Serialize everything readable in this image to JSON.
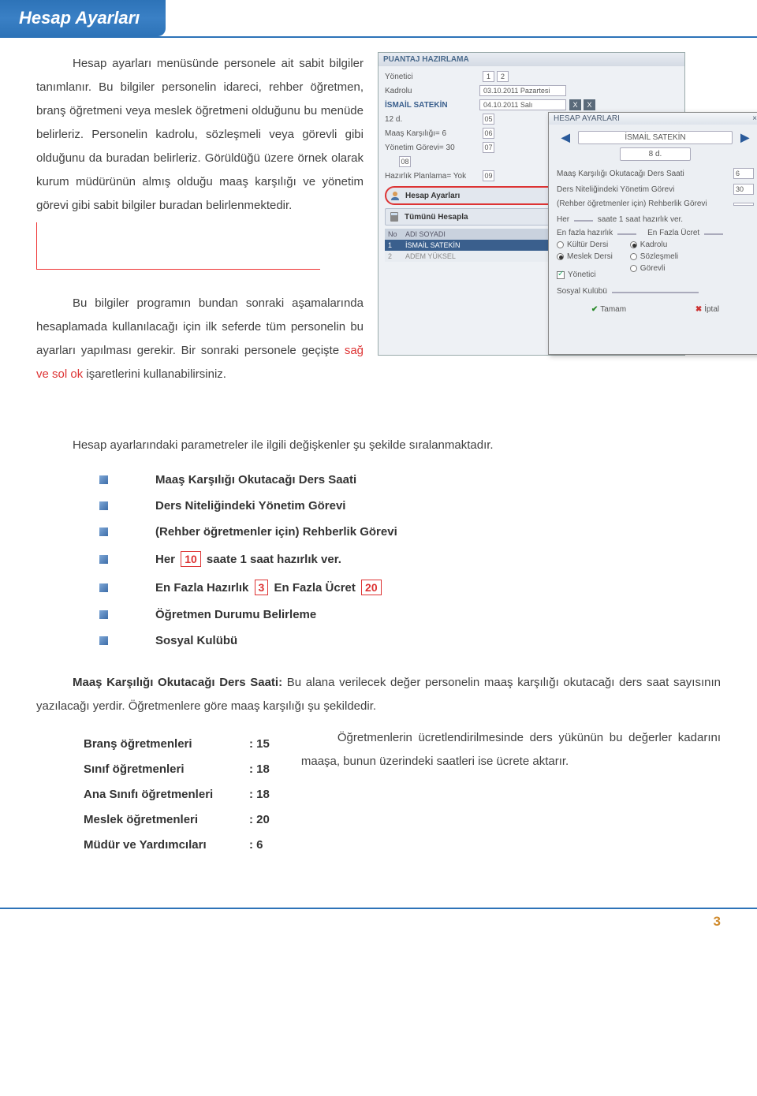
{
  "header": {
    "title": "Hesap Ayarları"
  },
  "body": {
    "p1": "Hesap ayarları menüsünde personele ait sabit bilgiler tanımlanır. Bu bilgiler personelin idareci, rehber öğretmen, branş öğretmeni veya meslek öğretmeni olduğunu bu menüde belirleriz. Personelin kadrolu, sözleşmeli veya görevli gibi olduğunu da buradan belirleriz. Görüldüğü üzere örnek olarak kurum müdürünün almış olduğu maaş karşılığı ve yönetim görevi gibi sabit bilgiler buradan belirlenmektedir.",
    "p2a": "Bu bilgiler programın bundan sonraki aşamalarında hesaplamada kullanılacağı için ilk seferde tüm personelin bu ayarları yapılması gerekir. Bir sonraki personele geçişte ",
    "p2_red1": "sağ ve sol ok",
    "p2b": " işaretlerini kullanabilirsiniz.",
    "p3": "Hesap ayarlarındaki parametreler ile ilgili değişkenler şu şekilde sıralanmaktadır.",
    "p4a": "Maaş Karşılığı Okutacağı Ders Saati:",
    "p4b": " Bu alana verilecek değer personelin maaş karşılığı okutacağı ders saat sayısının yazılacağı yerdir. Öğretmenlere göre maaş karşılığı şu şekildedir.",
    "p5": "Öğretmenlerin ücretlendirilmesinde ders yükünün bu değerler kadarını maaşa, bunun üzerindeki saatleri ise ücrete aktarır."
  },
  "bullets": {
    "b1": "Maaş Karşılığı Okutacağı Ders Saati",
    "b2": "Ders Niteliğindeki Yönetim Görevi",
    "b3": "(Rehber öğretmenler için) Rehberlik Görevi",
    "b4a": "Her ",
    "b4_box": "10",
    "b4b": " saate 1 saat hazırlık ver.",
    "b5a": "En Fazla Hazırlık ",
    "b5_box1": "3",
    "b5b": "   En Fazla Ücret  ",
    "b5_box2": "20",
    "b6": "Öğretmen Durumu Belirleme",
    "b7": "Sosyal Kulübü"
  },
  "table": {
    "r1k": "Branş öğretmenleri",
    "r1v": ": 15",
    "r2k": "Sınıf öğretmenleri",
    "r2v": ": 18",
    "r3k": "Ana Sınıfı öğretmenleri",
    "r3v": ": 18",
    "r4k": "Meslek öğretmenleri",
    "r4v": ": 20",
    "r5k": "Müdür ve Yardımcıları",
    "r5v": ": 6"
  },
  "app": {
    "title": "PUANTAJ HAZIRLAMA",
    "rows": {
      "r1_lbl": "Yönetici",
      "r2_lbl": "Kadrolu",
      "r2_val": "03.10.2011 Pazartesi",
      "r3_lbl": "İSMAİL SATEKİN",
      "r3_val": "04.10.2011 Salı",
      "r4_lbl": "12 d.",
      "r5_lbl": "Maaş Karşılığı= 6",
      "r6_lbl": "Yönetim Görevi= 30",
      "r7_lbl": "Hazırlık Planlama= Yok"
    },
    "nums": {
      "n1": "1",
      "n2": "2",
      "x1": "X",
      "x2": "X",
      "d05": "05",
      "d06": "06",
      "d07": "07",
      "d08": "08",
      "d09": "09"
    },
    "btn1": "Hesap Ayarları",
    "btn2": "Tümünü Hesapla",
    "list": {
      "h_no": "No",
      "h_name": "ADI SOYADI",
      "r1_no": "1",
      "r1_name": "İSMAİL SATEKİN",
      "r2_no": "2",
      "r2_name": "ADEM YÜKSEL"
    }
  },
  "dialog": {
    "title": "HESAP AYARLARI",
    "person": "İSMAİL SATEKİN",
    "person_sub": "8 d.",
    "f1_lbl": "Maaş Karşılığı Okutacağı Ders Saati",
    "f1_val": "6",
    "f2_lbl": "Ders Niteliğindeki Yönetim Görevi",
    "f2_val": "30",
    "f3_lbl": "(Rehber öğretmenler için) Rehberlik Görevi",
    "her_a": "Her",
    "her_b": "saate 1 saat hazırlık ver.",
    "enf_a": "En fazla hazırlık",
    "enf_b": "En Fazla Ücret",
    "radios": {
      "c1a": "Kültür Dersi",
      "c1b": "Meslek Dersi",
      "c2a": "Kadrolu",
      "c2b": "Sözleşmeli",
      "c2c": "Görevli"
    },
    "chk1": "Yönetici",
    "sosyal": "Sosyal Kulübü",
    "ok": "Tamam",
    "cancel": "İptal"
  },
  "footer": {
    "page": "3"
  }
}
